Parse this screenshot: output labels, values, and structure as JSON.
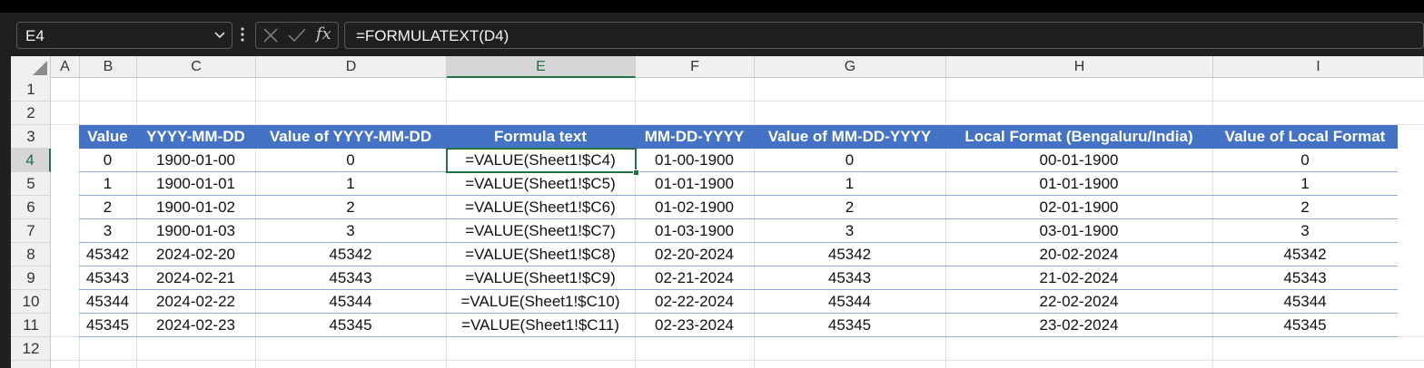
{
  "name_box": {
    "value": "E4"
  },
  "formula_bar": {
    "fx_label": "fx",
    "value": "=FORMULATEXT(D4)"
  },
  "columns": [
    "A",
    "B",
    "C",
    "D",
    "E",
    "F",
    "G",
    "H",
    "I"
  ],
  "selected_column": "E",
  "rows": [
    "1",
    "2",
    "3",
    "4",
    "5",
    "6",
    "7",
    "8",
    "9",
    "10",
    "11",
    "12"
  ],
  "selected_row": "4",
  "table": {
    "headers": [
      "Value",
      "YYYY-MM-DD",
      "Value of YYYY-MM-DD",
      "Formula text",
      "MM-DD-YYYY",
      "Value of MM-DD-YYYY",
      "Local Format (Bengaluru/India)",
      "Value of Local Format"
    ],
    "rows": [
      [
        "0",
        "1900-01-00",
        "0",
        "=VALUE(Sheet1!$C4)",
        "01-00-1900",
        "0",
        "00-01-1900",
        "0"
      ],
      [
        "1",
        "1900-01-01",
        "1",
        "=VALUE(Sheet1!$C5)",
        "01-01-1900",
        "1",
        "01-01-1900",
        "1"
      ],
      [
        "2",
        "1900-01-02",
        "2",
        "=VALUE(Sheet1!$C6)",
        "01-02-1900",
        "2",
        "02-01-1900",
        "2"
      ],
      [
        "3",
        "1900-01-03",
        "3",
        "=VALUE(Sheet1!$C7)",
        "01-03-1900",
        "3",
        "03-01-1900",
        "3"
      ],
      [
        "45342",
        "2024-02-20",
        "45342",
        "=VALUE(Sheet1!$C8)",
        "02-20-2024",
        "45342",
        "20-02-2024",
        "45342"
      ],
      [
        "45343",
        "2024-02-21",
        "45343",
        "=VALUE(Sheet1!$C9)",
        "02-21-2024",
        "45343",
        "21-02-2024",
        "45343"
      ],
      [
        "45344",
        "2024-02-22",
        "45344",
        "=VALUE(Sheet1!$C10)",
        "02-22-2024",
        "45344",
        "22-02-2024",
        "45344"
      ],
      [
        "45345",
        "2024-02-23",
        "45345",
        "=VALUE(Sheet1!$C11)",
        "02-23-2024",
        "45345",
        "23-02-2024",
        "45345"
      ]
    ]
  },
  "colors": {
    "table_header": "#4472c4",
    "selection": "#217346"
  }
}
